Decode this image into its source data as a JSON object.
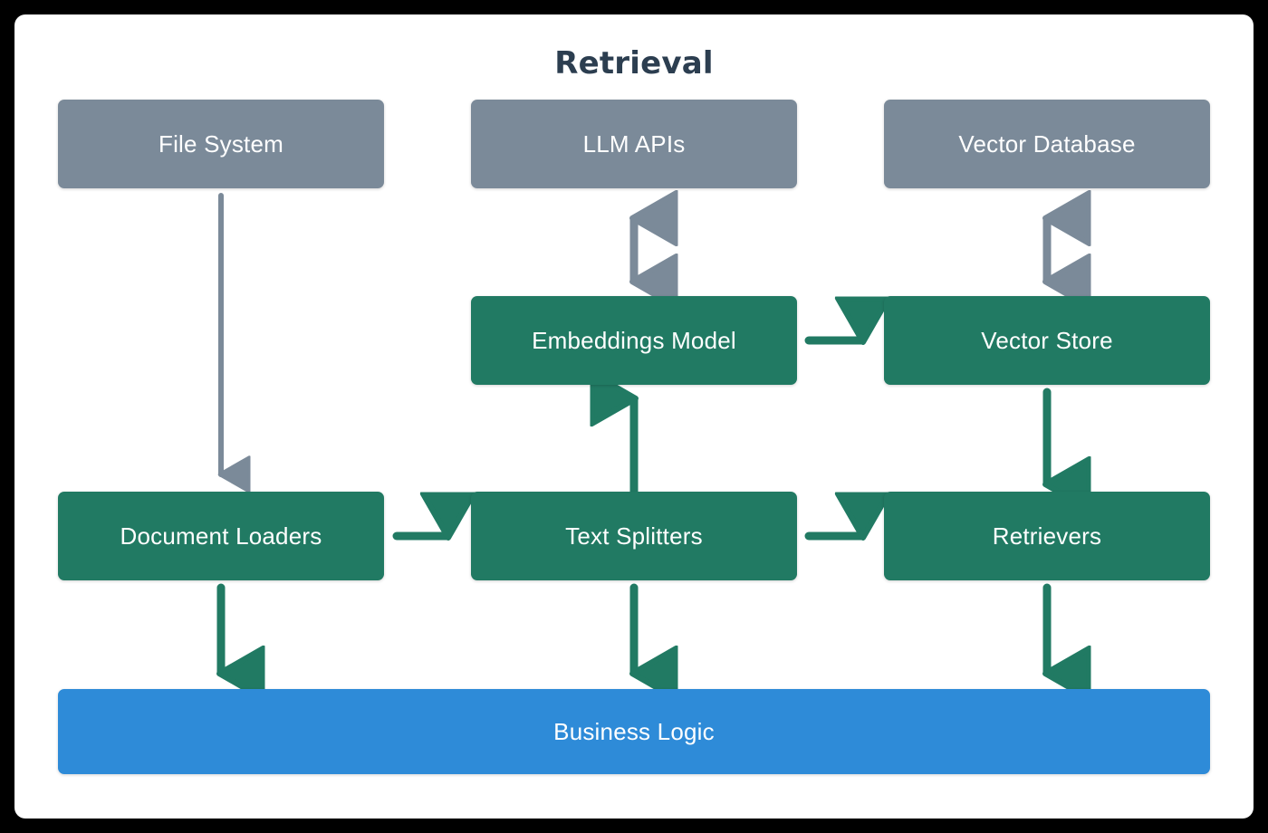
{
  "diagram": {
    "title": "Retrieval",
    "title_color": "#2c3e50",
    "background": "#ffffff",
    "frame_color": "#000000",
    "legend_colors": {
      "external": "#7b8a99",
      "core": "#217a63",
      "application": "#2e8bd8"
    },
    "nodes": [
      {
        "id": "file_system",
        "label": "File System",
        "group": "external",
        "color": "#7b8a99",
        "row": 1,
        "column": 1
      },
      {
        "id": "llm_apis",
        "label": "LLM APIs",
        "group": "external",
        "color": "#7b8a99",
        "row": 1,
        "column": 2
      },
      {
        "id": "vector_database",
        "label": "Vector Database",
        "group": "external",
        "color": "#7b8a99",
        "row": 1,
        "column": 3
      },
      {
        "id": "embeddings_model",
        "label": "Embeddings Model",
        "group": "core",
        "color": "#217a63",
        "row": 2,
        "column": 2
      },
      {
        "id": "vector_store",
        "label": "Vector Store",
        "group": "core",
        "color": "#217a63",
        "row": 2,
        "column": 3
      },
      {
        "id": "document_loaders",
        "label": "Document Loaders",
        "group": "core",
        "color": "#217a63",
        "row": 3,
        "column": 1
      },
      {
        "id": "text_splitters",
        "label": "Text Splitters",
        "group": "core",
        "color": "#217a63",
        "row": 3,
        "column": 2
      },
      {
        "id": "retrievers",
        "label": "Retrievers",
        "group": "core",
        "color": "#217a63",
        "row": 3,
        "column": 3
      },
      {
        "id": "business_logic",
        "label": "Business Logic",
        "group": "application",
        "color": "#2e8bd8",
        "row": 4,
        "column": "span-all"
      }
    ],
    "edges": [
      {
        "from": "file_system",
        "to": "document_loaders",
        "direction": "down",
        "style": "solid",
        "color": "#7b8a99"
      },
      {
        "from": "llm_apis",
        "to": "embeddings_model",
        "direction": "both",
        "style": "solid",
        "color": "#7b8a99"
      },
      {
        "from": "vector_database",
        "to": "vector_store",
        "direction": "both",
        "style": "solid",
        "color": "#7b8a99"
      },
      {
        "from": "embeddings_model",
        "to": "vector_store",
        "direction": "right",
        "style": "solid",
        "color": "#217a63"
      },
      {
        "from": "text_splitters",
        "to": "embeddings_model",
        "direction": "up",
        "style": "solid",
        "color": "#217a63"
      },
      {
        "from": "vector_store",
        "to": "retrievers",
        "direction": "down",
        "style": "solid",
        "color": "#217a63"
      },
      {
        "from": "document_loaders",
        "to": "text_splitters",
        "direction": "right",
        "style": "solid",
        "color": "#217a63"
      },
      {
        "from": "text_splitters",
        "to": "retrievers",
        "direction": "right",
        "style": "solid",
        "color": "#217a63"
      },
      {
        "from": "document_loaders",
        "to": "business_logic",
        "direction": "down",
        "style": "solid",
        "color": "#217a63"
      },
      {
        "from": "text_splitters",
        "to": "business_logic",
        "direction": "down",
        "style": "solid",
        "color": "#217a63"
      },
      {
        "from": "retrievers",
        "to": "business_logic",
        "direction": "down",
        "style": "solid",
        "color": "#217a63"
      }
    ]
  }
}
